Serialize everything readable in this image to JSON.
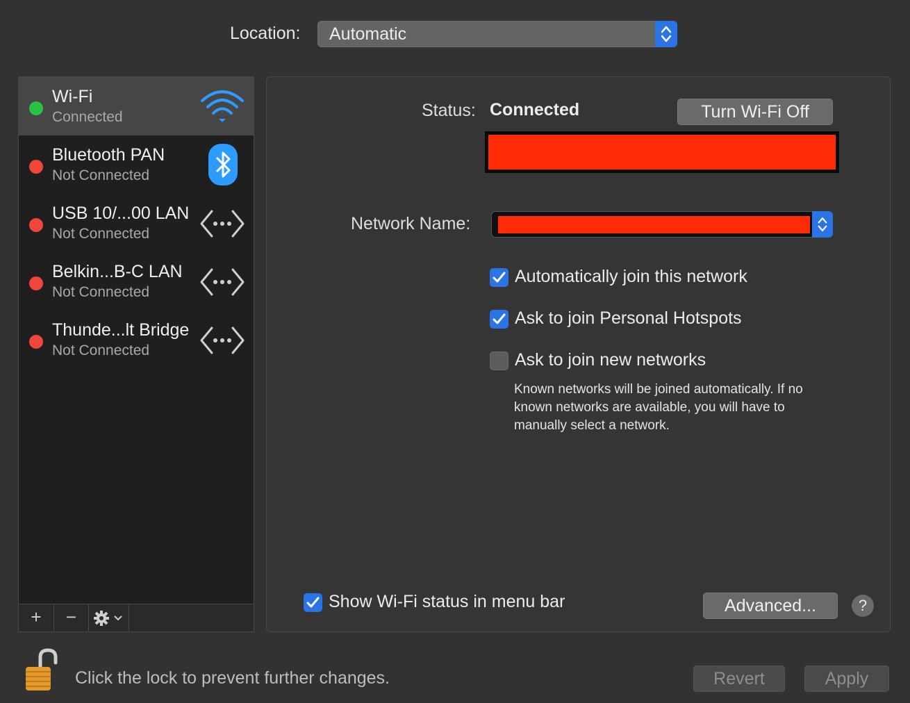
{
  "location": {
    "label": "Location:",
    "value": "Automatic"
  },
  "services": [
    {
      "name": "Wi-Fi",
      "status": "Connected",
      "state": "green",
      "icon": "wifi-icon"
    },
    {
      "name": "Bluetooth PAN",
      "status": "Not Connected",
      "state": "red",
      "icon": "bluetooth-icon"
    },
    {
      "name": "USB 10/...00 LAN",
      "status": "Not Connected",
      "state": "red",
      "icon": "ethernet-icon"
    },
    {
      "name": "Belkin...B-C LAN",
      "status": "Not Connected",
      "state": "red",
      "icon": "ethernet-icon"
    },
    {
      "name": "Thunde...lt Bridge",
      "status": "Not Connected",
      "state": "red",
      "icon": "ethernet-icon"
    }
  ],
  "sidebar_footer": {
    "add": "+",
    "remove": "−"
  },
  "detail": {
    "status_label": "Status:",
    "status_value": "Connected",
    "turn_off_button": "Turn Wi-Fi Off",
    "network_name_label": "Network Name:",
    "options": [
      {
        "label": "Automatically join this network",
        "checked": true
      },
      {
        "label": "Ask to join Personal Hotspots",
        "checked": true
      },
      {
        "label": "Ask to join new networks",
        "checked": false
      }
    ],
    "help_text": "Known networks will be joined automatically. If no known networks are available, you will have to manually select a network.",
    "show_status_label": "Show Wi-Fi status in menu bar",
    "show_status_checked": true,
    "advanced_button": "Advanced...",
    "help_button": "?"
  },
  "bottom": {
    "lock_text": "Click the lock to prevent further changes.",
    "revert_button": "Revert",
    "apply_button": "Apply"
  },
  "colors": {
    "accent": "#2a74e6",
    "connected": "#29c244",
    "disconnected": "#f0463c",
    "redaction": "#ff2a06"
  }
}
